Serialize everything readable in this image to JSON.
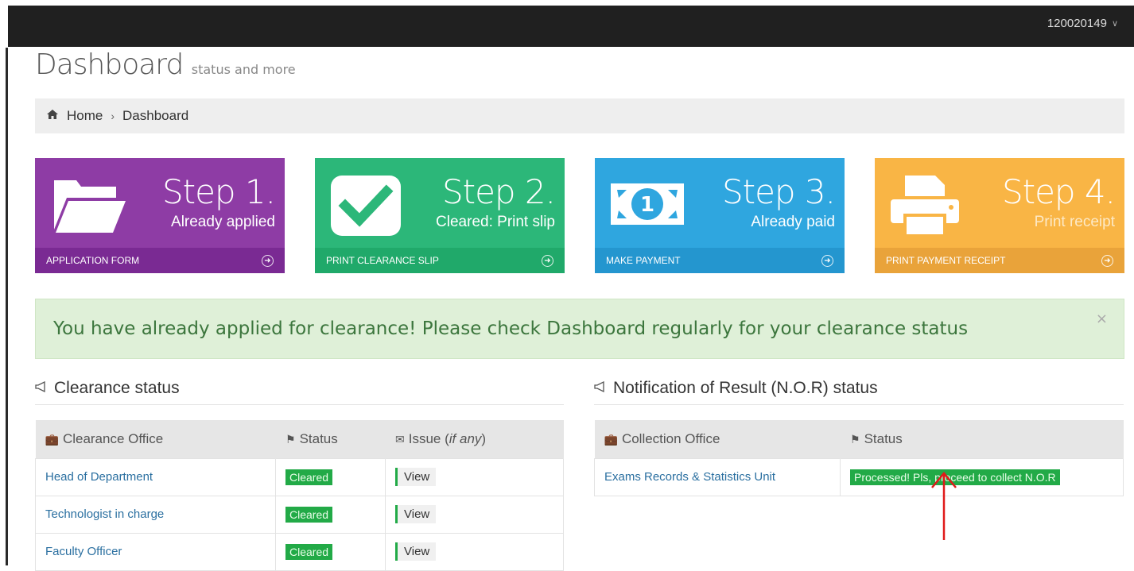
{
  "topbar": {
    "user": "120020149",
    "user_chevron": "chevron-down-icon"
  },
  "page": {
    "title": "Dashboard",
    "subtitle": "status and more"
  },
  "breadcrumb": {
    "home": "Home",
    "current": "Dashboard"
  },
  "tiles": [
    {
      "step": "Step 1.",
      "desc": "Already applied",
      "link": "APPLICATION FORM",
      "icon": "folder-open-icon",
      "color": "#8e3ca5"
    },
    {
      "step": "Step 2.",
      "desc": "Cleared: Print slip",
      "link": "PRINT CLEARANCE SLIP",
      "icon": "check-square-icon",
      "color": "#2cb779"
    },
    {
      "step": "Step 3.",
      "desc": "Already paid",
      "link": "MAKE PAYMENT",
      "icon": "money-icon",
      "color": "#2fa6df"
    },
    {
      "step": "Step 4.",
      "desc": "Print receipt",
      "link": "PRINT PAYMENT RECEIPT",
      "icon": "print-icon",
      "color": "#f9b545"
    }
  ],
  "money_digit": "1",
  "alert": {
    "text": "You have already applied for clearance! Please check Dashboard regularly for your clearance status",
    "close": "×"
  },
  "clearance": {
    "title": "Clearance status",
    "headers": {
      "office": "Clearance Office",
      "status": "Status",
      "issue": "Issue",
      "issue_note": "if any"
    },
    "rows": [
      {
        "office": "Head of Department",
        "status": "Cleared",
        "issue": "View"
      },
      {
        "office": "Technologist in charge",
        "status": "Cleared",
        "issue": "View"
      },
      {
        "office": "Faculty Officer",
        "status": "Cleared",
        "issue": "View"
      }
    ]
  },
  "nor": {
    "title": "Notification of Result (N.O.R) status",
    "headers": {
      "office": "Collection Office",
      "status": "Status"
    },
    "rows": [
      {
        "office": "Exams Records & Statistics Unit",
        "status": "Processed! Pls, proceed to collect N.O.R"
      }
    ]
  },
  "colors": {
    "success_green": "#22aa47",
    "alert_bg": "#dff0d8",
    "annotation_red": "#e01a1a"
  }
}
